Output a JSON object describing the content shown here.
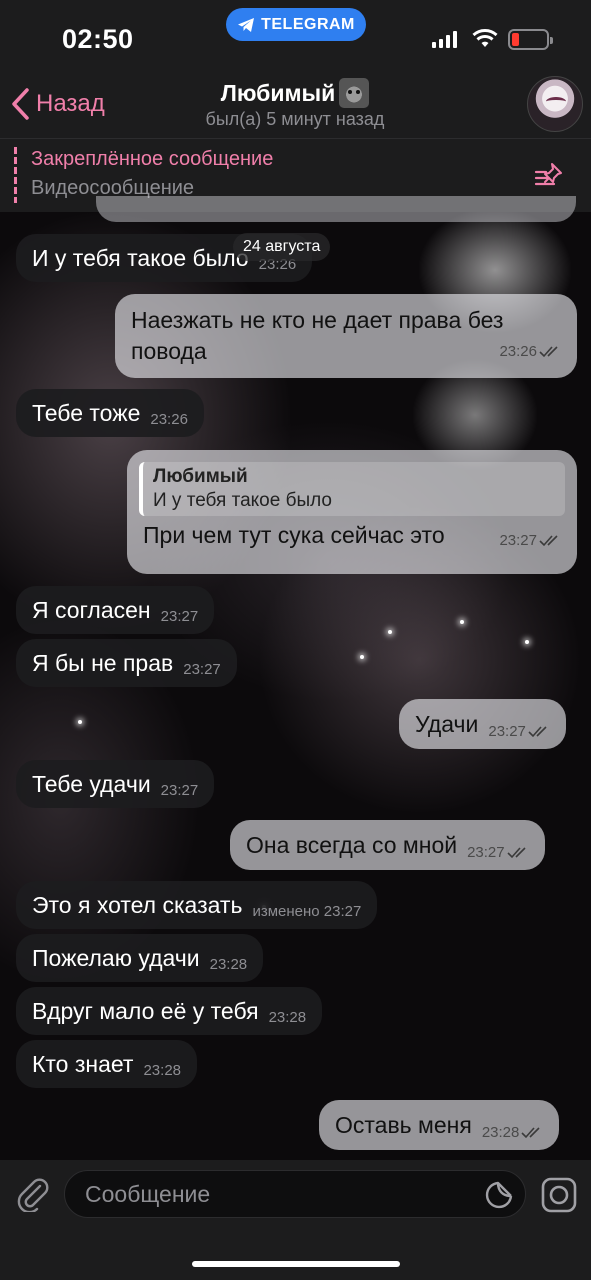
{
  "status_bar": {
    "time": "02:50",
    "app_pill": "TELEGRAM",
    "battery_color": "#ff3b30"
  },
  "header": {
    "back_label": "Назад",
    "contact_name": "Любимый",
    "last_seen": "был(а) 5 минут назад",
    "accent_color": "#f07faa"
  },
  "pinned": {
    "title": "Закреплённое сообщение",
    "text": "Видеосообщение"
  },
  "date_separator": "24 августа",
  "messages": [
    {
      "dir": "in",
      "text": "И у тебя такое было",
      "time": "23:26"
    },
    {
      "dir": "out",
      "text_line1": "Наезжать не кто не дает права без",
      "text_line2": "повода",
      "time": "23:26"
    },
    {
      "dir": "in",
      "text": "Тебе тоже",
      "time": "23:26"
    },
    {
      "dir": "out",
      "reply_name": "Любимый",
      "reply_text": "И у тебя такое было",
      "text": "При чем тут сука сейчас это",
      "time": "23:27"
    },
    {
      "dir": "in",
      "text": "Я согласен",
      "time": "23:27"
    },
    {
      "dir": "in",
      "text": "Я бы не прав",
      "time": "23:27"
    },
    {
      "dir": "out",
      "text": "Удачи",
      "time": "23:27"
    },
    {
      "dir": "in",
      "text": "Тебе удачи",
      "time": "23:27"
    },
    {
      "dir": "out",
      "text": "Она всегда со мной",
      "time": "23:27"
    },
    {
      "dir": "in",
      "text": "Это я хотел сказать",
      "time": "изменено 23:27"
    },
    {
      "dir": "in",
      "text": "Пожелаю удачи",
      "time": "23:28"
    },
    {
      "dir": "in",
      "text": "Вдруг мало её у тебя",
      "time": "23:28"
    },
    {
      "dir": "in",
      "text": "Кто знает",
      "time": "23:28"
    },
    {
      "dir": "out",
      "text": "Оставь меня",
      "time": "23:28"
    }
  ],
  "composer": {
    "placeholder": "Сообщение"
  }
}
